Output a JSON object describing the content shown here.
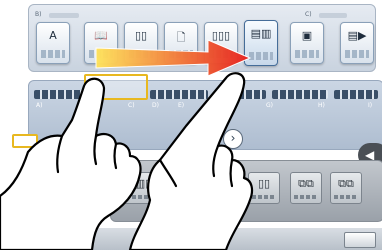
{
  "screen": {
    "panel_headers": {
      "left": "B)",
      "right": "C)"
    },
    "function_buttons": [
      {
        "name": "fn-text",
        "icon": "A",
        "icon_name": "text-doc-icon"
      },
      {
        "name": "fn-book",
        "icon": "📖",
        "icon_name": "book-icon"
      },
      {
        "name": "fn-duplex",
        "icon": "▯▯",
        "icon_name": "duplex-icon"
      },
      {
        "name": "fn-page",
        "icon": "🗋",
        "icon_name": "page-icon"
      },
      {
        "name": "fn-multi",
        "icon": "▯▯▯",
        "icon_name": "multi-page-icon"
      },
      {
        "name": "fn-layout",
        "icon": "▤▥",
        "icon_name": "layout-icon"
      },
      {
        "name": "fn-copy",
        "icon": "▣",
        "icon_name": "copy-icon"
      },
      {
        "name": "fn-combine",
        "icon": "▤▶",
        "icon_name": "combine-icon"
      }
    ],
    "mid_labels": [
      "A)",
      "C)",
      "D)",
      "E)",
      "G)",
      "H)",
      "I)"
    ],
    "next_icon": "›",
    "side_icon": "◀",
    "bottom_tiles": [
      {
        "name": "tile-1",
        "icon": "▥▥▥"
      },
      {
        "name": "tile-2",
        "icon": "▯▯"
      },
      {
        "name": "tile-3",
        "icon": "▯▯"
      },
      {
        "name": "tile-4",
        "icon": "▯▯"
      },
      {
        "name": "tile-5",
        "icon": "⧉⧉"
      },
      {
        "name": "tile-6",
        "icon": "⧉⧉"
      }
    ],
    "colors": {
      "arrow_start": "#ffe45c",
      "arrow_end": "#e8201e",
      "highlight": "#e8b820"
    }
  }
}
